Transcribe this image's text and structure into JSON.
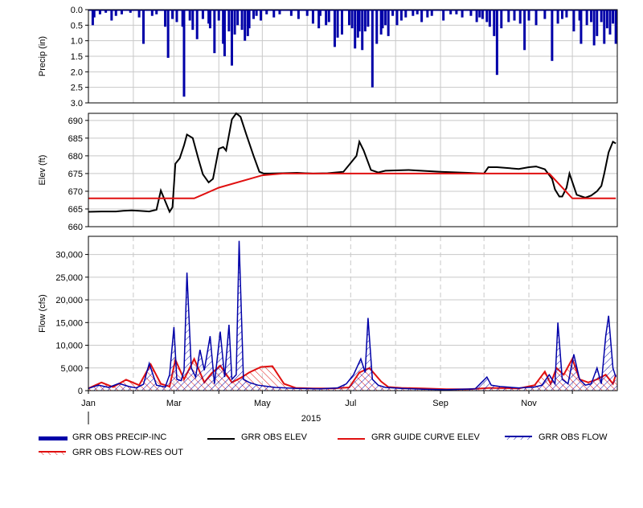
{
  "chart_data": [
    {
      "type": "bar",
      "panel": "precip",
      "ylabel": "Precip (in)",
      "ylim": [
        3.0,
        0.0
      ],
      "yticks": [
        "0.0",
        "0.5",
        "1.0",
        "1.5",
        "2.0",
        "2.5",
        "3.0"
      ],
      "inverted": true,
      "grid": true,
      "series": [
        {
          "name": "GRR OBS PRECIP-INC",
          "color": "#0000a8",
          "x": [
            "2015-01-04",
            "2015-01-05",
            "2015-01-09",
            "2015-01-13",
            "2015-01-17",
            "2015-01-20",
            "2015-01-24",
            "2015-01-30",
            "2015-02-05",
            "2015-02-08",
            "2015-02-14",
            "2015-02-17",
            "2015-02-23",
            "2015-02-25",
            "2015-02-28",
            "2015-03-03",
            "2015-03-07",
            "2015-03-08",
            "2015-03-12",
            "2015-03-14",
            "2015-03-17",
            "2015-03-21",
            "2015-03-25",
            "2015-03-26",
            "2015-03-29",
            "2015-04-01",
            "2015-04-04",
            "2015-04-05",
            "2015-04-08",
            "2015-04-10",
            "2015-04-12",
            "2015-04-14",
            "2015-04-17",
            "2015-04-19",
            "2015-04-21",
            "2015-04-22",
            "2015-04-25",
            "2015-04-27",
            "2015-04-30",
            "2015-05-04",
            "2015-05-09",
            "2015-05-13",
            "2015-05-21",
            "2015-05-26",
            "2015-06-01",
            "2015-06-05",
            "2015-06-09",
            "2015-06-10",
            "2015-06-14",
            "2015-06-16",
            "2015-06-20",
            "2015-06-22",
            "2015-06-25",
            "2015-06-30",
            "2015-07-02",
            "2015-07-04",
            "2015-07-06",
            "2015-07-07",
            "2015-07-09",
            "2015-07-11",
            "2015-07-13",
            "2015-07-16",
            "2015-07-19",
            "2015-07-22",
            "2015-07-23",
            "2015-07-25",
            "2015-07-27",
            "2015-07-30",
            "2015-08-02",
            "2015-08-05",
            "2015-08-08",
            "2015-08-13",
            "2015-08-16",
            "2015-08-19",
            "2015-08-23",
            "2015-08-26",
            "2015-09-03",
            "2015-09-08",
            "2015-09-12",
            "2015-09-16",
            "2015-09-22",
            "2015-09-26",
            "2015-09-28",
            "2015-09-30",
            "2015-10-03",
            "2015-10-05",
            "2015-10-08",
            "2015-10-10",
            "2015-10-13",
            "2015-10-18",
            "2015-10-22",
            "2015-10-26",
            "2015-10-29",
            "2015-11-01",
            "2015-11-06",
            "2015-11-12",
            "2015-11-17",
            "2015-11-21",
            "2015-11-24",
            "2015-11-27",
            "2015-12-02",
            "2015-12-06",
            "2015-12-07",
            "2015-12-11",
            "2015-12-14",
            "2015-12-16",
            "2015-12-18",
            "2015-12-21",
            "2015-12-23",
            "2015-12-25",
            "2015-12-27",
            "2015-12-29",
            "2015-12-31"
          ],
          "values": [
            0.5,
            0.25,
            0.15,
            0.1,
            0.35,
            0.2,
            0.15,
            0.1,
            0.25,
            1.1,
            0.2,
            0.15,
            0.55,
            1.55,
            0.3,
            0.4,
            0.55,
            2.8,
            0.35,
            0.65,
            0.95,
            0.3,
            0.45,
            0.6,
            1.4,
            0.35,
            1.1,
            1.5,
            0.7,
            1.8,
            0.8,
            0.5,
            0.65,
            1.0,
            0.85,
            0.6,
            0.3,
            0.2,
            0.35,
            0.15,
            0.25,
            0.15,
            0.2,
            0.3,
            0.2,
            0.45,
            0.6,
            0.2,
            0.5,
            0.4,
            1.2,
            0.9,
            0.8,
            0.5,
            0.6,
            1.25,
            0.9,
            0.7,
            1.3,
            0.7,
            0.55,
            2.5,
            1.1,
            0.8,
            0.6,
            0.5,
            0.85,
            0.2,
            0.5,
            0.35,
            0.25,
            0.2,
            0.15,
            0.4,
            0.25,
            0.2,
            0.35,
            0.15,
            0.15,
            0.25,
            0.2,
            0.4,
            0.25,
            0.3,
            0.4,
            0.55,
            0.85,
            2.1,
            0.6,
            0.4,
            0.35,
            0.45,
            1.3,
            0.35,
            0.5,
            0.3,
            1.65,
            0.45,
            0.3,
            0.25,
            0.7,
            0.35,
            1.1,
            0.5,
            0.4,
            1.15,
            0.85,
            0.4,
            1.1,
            0.6,
            0.8,
            0.45,
            1.1
          ]
        }
      ]
    },
    {
      "type": "line",
      "panel": "elev",
      "ylabel": "Elev (ft)",
      "ylim": [
        660,
        692
      ],
      "yticks": [
        "660",
        "665",
        "670",
        "675",
        "680",
        "685",
        "690"
      ],
      "grid": true,
      "series": [
        {
          "name": "GRR OBS ELEV",
          "color": "#000000",
          "x": [
            "2015-01-01",
            "2015-01-10",
            "2015-01-20",
            "2015-01-25",
            "2015-01-31",
            "2015-02-05",
            "2015-02-12",
            "2015-02-17",
            "2015-02-20",
            "2015-02-26",
            "2015-02-28",
            "2015-03-02",
            "2015-03-05",
            "2015-03-08",
            "2015-03-10",
            "2015-03-14",
            "2015-03-18",
            "2015-03-21",
            "2015-03-25",
            "2015-03-28",
            "2015-04-01",
            "2015-04-04",
            "2015-04-06",
            "2015-04-10",
            "2015-04-13",
            "2015-04-16",
            "2015-04-20",
            "2015-04-25",
            "2015-04-29",
            "2015-05-02",
            "2015-05-06",
            "2015-05-15",
            "2015-05-25",
            "2015-06-05",
            "2015-06-15",
            "2015-06-26",
            "2015-07-01",
            "2015-07-05",
            "2015-07-07",
            "2015-07-10",
            "2015-07-15",
            "2015-07-20",
            "2015-07-25",
            "2015-08-10",
            "2015-09-01",
            "2015-09-20",
            "2015-10-01",
            "2015-10-04",
            "2015-10-10",
            "2015-10-25",
            "2015-11-01",
            "2015-11-06",
            "2015-11-12",
            "2015-11-17",
            "2015-11-19",
            "2015-11-22",
            "2015-11-24",
            "2015-11-27",
            "2015-11-29",
            "2015-12-04",
            "2015-12-10",
            "2015-12-14",
            "2015-12-18",
            "2015-12-21",
            "2015-12-23",
            "2015-12-26",
            "2015-12-29",
            "2015-12-31"
          ],
          "values": [
            664.2,
            664.3,
            664.3,
            664.5,
            664.6,
            664.5,
            664.3,
            664.8,
            670.2,
            664.2,
            665.5,
            677.8,
            679.3,
            683.0,
            686.0,
            685.0,
            679.0,
            674.8,
            672.5,
            673.5,
            682.0,
            682.5,
            681.5,
            690.3,
            692.0,
            691.0,
            686.0,
            680.0,
            675.5,
            675.0,
            675.0,
            675.1,
            675.2,
            675.0,
            675.1,
            675.5,
            678.0,
            680.0,
            684.0,
            681.5,
            676.0,
            675.3,
            675.8,
            676.0,
            675.5,
            675.2,
            675.0,
            676.8,
            676.8,
            676.3,
            676.8,
            677.0,
            676.2,
            673.5,
            670.5,
            668.5,
            668.5,
            671.0,
            675.0,
            669.0,
            668.2,
            668.8,
            670.0,
            671.5,
            675.0,
            681.0,
            684.0,
            683.5
          ]
        },
        {
          "name": "GRR GUIDE CURVE ELEV",
          "color": "#e01010",
          "x": [
            "2015-01-01",
            "2015-03-15",
            "2015-04-01",
            "2015-05-01",
            "2015-05-15",
            "2015-06-01",
            "2015-10-01",
            "2015-11-15",
            "2015-12-01",
            "2015-12-31"
          ],
          "values": [
            668,
            668,
            671,
            674.5,
            675,
            675,
            675,
            675,
            668,
            668
          ]
        }
      ]
    },
    {
      "type": "area",
      "panel": "flow",
      "ylabel": "Flow (cfs)",
      "ylim": [
        0,
        34000
      ],
      "yticks": [
        "0",
        "5,000",
        "10,000",
        "15,000",
        "20,000",
        "25,000",
        "30,000"
      ],
      "xticks": [
        "Jan",
        "Mar",
        "May",
        "Jul",
        "Sep",
        "Nov"
      ],
      "year_label": "2015",
      "grid": true,
      "series": [
        {
          "name": "GRR OBS FLOW",
          "color": "#0000a8",
          "x": [
            "2015-01-01",
            "2015-01-08",
            "2015-01-15",
            "2015-01-22",
            "2015-01-29",
            "2015-02-03",
            "2015-02-08",
            "2015-02-12",
            "2015-02-17",
            "2015-02-23",
            "2015-02-26",
            "2015-03-01",
            "2015-03-03",
            "2015-03-06",
            "2015-03-08",
            "2015-03-10",
            "2015-03-13",
            "2015-03-16",
            "2015-03-19",
            "2015-03-22",
            "2015-03-26",
            "2015-03-29",
            "2015-04-02",
            "2015-04-05",
            "2015-04-08",
            "2015-04-10",
            "2015-04-13",
            "2015-04-15",
            "2015-04-18",
            "2015-04-22",
            "2015-04-28",
            "2015-05-10",
            "2015-05-25",
            "2015-06-10",
            "2015-06-22",
            "2015-06-28",
            "2015-07-03",
            "2015-07-08",
            "2015-07-11",
            "2015-07-13",
            "2015-07-16",
            "2015-07-20",
            "2015-07-25",
            "2015-08-05",
            "2015-08-20",
            "2015-09-05",
            "2015-09-25",
            "2015-10-03",
            "2015-10-06",
            "2015-10-12",
            "2015-10-25",
            "2015-11-05",
            "2015-11-10",
            "2015-11-15",
            "2015-11-19",
            "2015-11-21",
            "2015-11-24",
            "2015-11-28",
            "2015-12-02",
            "2015-12-06",
            "2015-12-10",
            "2015-12-14",
            "2015-12-18",
            "2015-12-21",
            "2015-12-24",
            "2015-12-26",
            "2015-12-29",
            "2015-12-31"
          ],
          "values": [
            500,
            1200,
            700,
            1600,
            900,
            600,
            1400,
            6000,
            1200,
            800,
            3500,
            14000,
            2500,
            2200,
            4500,
            26000,
            5000,
            3000,
            9000,
            4500,
            12000,
            1500,
            13000,
            3000,
            14500,
            2500,
            3500,
            33000,
            2500,
            1800,
            1200,
            700,
            500,
            400,
            600,
            1500,
            3500,
            7000,
            4000,
            16000,
            2500,
            1200,
            700,
            500,
            300,
            200,
            400,
            3000,
            1200,
            900,
            600,
            800,
            1200,
            3500,
            1500,
            15000,
            2500,
            1500,
            8000,
            2500,
            1200,
            1500,
            5000,
            1500,
            12000,
            16500,
            5000,
            3000
          ]
        },
        {
          "name": "GRR OBS FLOW-RES OUT",
          "color": "#e01010",
          "x": [
            "2015-01-01",
            "2015-01-10",
            "2015-01-18",
            "2015-01-27",
            "2015-02-05",
            "2015-02-13",
            "2015-02-20",
            "2015-02-26",
            "2015-03-02",
            "2015-03-08",
            "2015-03-15",
            "2015-03-22",
            "2015-03-27",
            "2015-04-02",
            "2015-04-10",
            "2015-04-16",
            "2015-04-22",
            "2015-04-30",
            "2015-05-08",
            "2015-05-16",
            "2015-05-24",
            "2015-06-05",
            "2015-06-18",
            "2015-06-30",
            "2015-07-07",
            "2015-07-14",
            "2015-07-22",
            "2015-07-27",
            "2015-08-05",
            "2015-08-20",
            "2015-09-05",
            "2015-09-20",
            "2015-10-05",
            "2015-10-25",
            "2015-11-05",
            "2015-11-12",
            "2015-11-16",
            "2015-11-20",
            "2015-11-25",
            "2015-12-01",
            "2015-12-06",
            "2015-12-12",
            "2015-12-18",
            "2015-12-24",
            "2015-12-29",
            "2015-12-31"
          ],
          "values": [
            500,
            1800,
            800,
            2400,
            1200,
            5800,
            1500,
            900,
            6800,
            2500,
            7000,
            1800,
            3800,
            5500,
            1800,
            2800,
            4000,
            5200,
            5400,
            1500,
            600,
            500,
            500,
            700,
            4000,
            5000,
            2000,
            800,
            600,
            500,
            300,
            300,
            600,
            500,
            1200,
            4200,
            1500,
            5000,
            3500,
            7000,
            2500,
            1800,
            2500,
            3500,
            1500,
            3500
          ]
        }
      ]
    }
  ],
  "legend": [
    {
      "name": "GRR OBS PRECIP-INC",
      "color": "#0000a8",
      "style": "thick"
    },
    {
      "name": "GRR OBS ELEV",
      "color": "#000000",
      "style": "line"
    },
    {
      "name": "GRR GUIDE CURVE ELEV",
      "color": "#e01010",
      "style": "line"
    },
    {
      "name": "GRR OBS FLOW",
      "color": "#0000a8",
      "style": "hatch"
    },
    {
      "name": "GRR OBS FLOW-RES OUT",
      "color": "#e01010",
      "style": "hatch"
    }
  ]
}
